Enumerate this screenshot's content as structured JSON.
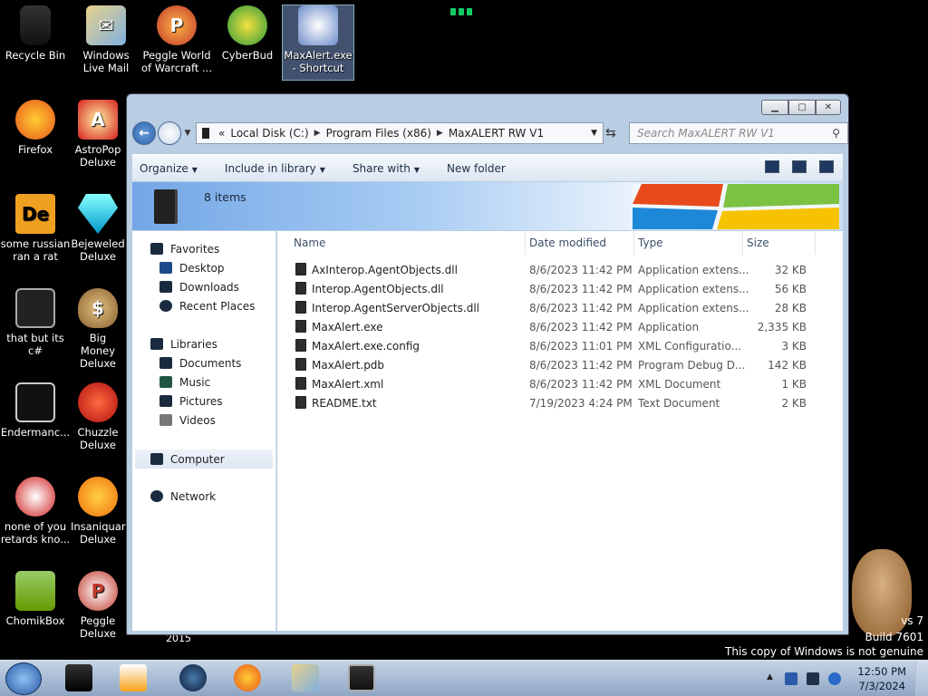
{
  "desktop": {
    "icons": [
      {
        "label": "Recycle Bin",
        "icon": "recycle-bin-icon"
      },
      {
        "label": "Windows Live Mail",
        "icon": "mail-icon"
      },
      {
        "label": "Peggle World of Warcraft ...",
        "icon": "peggle-icon"
      },
      {
        "label": "CyberBud",
        "icon": "cyberbud-icon"
      },
      {
        "label": "MaxAlert.exe - Shortcut",
        "icon": "maxalert-icon"
      },
      {
        "label": "Firefox",
        "icon": "firefox-icon"
      },
      {
        "label": "AstroPop Deluxe",
        "icon": "astropop-icon"
      },
      {
        "label": "some russian ran a rat",
        "icon": "de-icon"
      },
      {
        "label": "Bejeweled Deluxe",
        "icon": "bejeweled-icon"
      },
      {
        "label": "that but its c#",
        "icon": "copy-icon"
      },
      {
        "label": "Big Money Deluxe",
        "icon": "money-bag-icon"
      },
      {
        "label": "Endermanc...",
        "icon": "terminal-icon"
      },
      {
        "label": "Chuzzle Deluxe",
        "icon": "chuzzle-icon"
      },
      {
        "label": "none of you retards kno...",
        "icon": "dragon-icon"
      },
      {
        "label": "Insaniquarium Deluxe",
        "icon": "fish-icon"
      },
      {
        "label": "ChomikBox",
        "icon": "chomikbox-icon"
      },
      {
        "label": "Peggle Deluxe",
        "icon": "peggle-icon"
      }
    ],
    "year_text": "2015",
    "watermark": {
      "line1": "vs 7",
      "line2": "Build 7601",
      "line3": "This copy of Windows is not genuine"
    }
  },
  "window": {
    "address": {
      "crumbs": [
        "Local Disk (C:)",
        "Program Files (x86)",
        "MaxALERT RW V1"
      ]
    },
    "search_placeholder": "Search MaxALERT RW V1",
    "toolbar": {
      "organize": "Organize",
      "include": "Include in library",
      "share": "Share with",
      "new_folder": "New folder"
    },
    "item_count": "8 items",
    "nav": {
      "favorites": "Favorites",
      "desktop": "Desktop",
      "downloads": "Downloads",
      "recent": "Recent Places",
      "libraries": "Libraries",
      "documents": "Documents",
      "music": "Music",
      "pictures": "Pictures",
      "videos": "Videos",
      "computer": "Computer",
      "network": "Network"
    },
    "columns": {
      "name": "Name",
      "date": "Date modified",
      "type": "Type",
      "size": "Size"
    },
    "files": [
      {
        "name": "AxInterop.AgentObjects.dll",
        "date": "8/6/2023 11:42 PM",
        "type": "Application extens...",
        "size": "32 KB"
      },
      {
        "name": "Interop.AgentObjects.dll",
        "date": "8/6/2023 11:42 PM",
        "type": "Application extens...",
        "size": "56 KB"
      },
      {
        "name": "Interop.AgentServerObjects.dll",
        "date": "8/6/2023 11:42 PM",
        "type": "Application extens...",
        "size": "28 KB"
      },
      {
        "name": "MaxAlert.exe",
        "date": "8/6/2023 11:42 PM",
        "type": "Application",
        "size": "2,335 KB"
      },
      {
        "name": "MaxAlert.exe.config",
        "date": "8/6/2023 11:01 PM",
        "type": "XML Configuratio...",
        "size": "3 KB"
      },
      {
        "name": "MaxAlert.pdb",
        "date": "8/6/2023 11:42 PM",
        "type": "Program Debug D...",
        "size": "142 KB"
      },
      {
        "name": "MaxAlert.xml",
        "date": "8/6/2023 11:42 PM",
        "type": "XML Document",
        "size": "1 KB"
      },
      {
        "name": "README.txt",
        "date": "7/19/2023 4:24 PM",
        "type": "Text Document",
        "size": "2 KB"
      }
    ]
  },
  "taskbar": {
    "time": "12:50 PM",
    "date": "7/3/2024"
  }
}
